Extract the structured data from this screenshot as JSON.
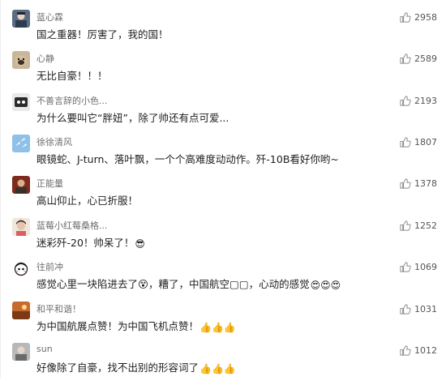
{
  "comments": [
    {
      "name": "蓝心霖",
      "text": "国之重器！厉害了，我的国！",
      "emoji": "",
      "likes": "2958"
    },
    {
      "name": "心静",
      "text": "无比自豪！！！",
      "emoji": "",
      "likes": "2589"
    },
    {
      "name": "不善言辞的小色...",
      "text": "为什么要叫它“胖妞”，除了帅还有点可爱...",
      "emoji": "",
      "likes": "2193"
    },
    {
      "name": "徐徐清风",
      "text": "眼镜蛇、J-turn、落叶飘，一个个高难度动动作。歼-10B看好你哟~",
      "emoji": "",
      "likes": "1807"
    },
    {
      "name": "正能量",
      "text": "高山仰止，心已折服！",
      "emoji": "",
      "likes": "1378"
    },
    {
      "name": "蓝莓小红莓桑格...",
      "text": "迷彩歼-20！帅呆了！",
      "emoji": "😎",
      "likes": "1252"
    },
    {
      "name": "往前冲",
      "text": "感觉心里一块陷进去了😵，糟了，中国航空▢▢，心动的感觉",
      "emoji": "😍😍😍",
      "likes": "1069"
    },
    {
      "name": "和平和谐！",
      "text": "为中国航展点赞！为中国飞机点赞！",
      "emoji": "👍👍👍",
      "likes": "1031"
    },
    {
      "name": "sun",
      "text": "好像除了自豪，找不出别的形容词了",
      "emoji": "👍👍👍",
      "likes": "1012"
    }
  ],
  "icons": {
    "like": "thumbs-up-icon"
  },
  "colors": {
    "name": "#6e6e6e",
    "text": "#1e1e1e",
    "count": "#555555"
  }
}
